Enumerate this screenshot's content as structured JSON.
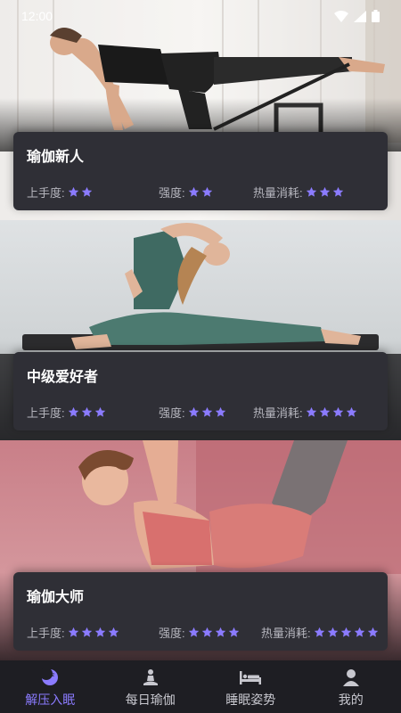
{
  "status_bar": {
    "time": "12:00"
  },
  "programs": [
    {
      "title": "瑜伽新人",
      "stats": [
        {
          "label": "上手度:",
          "stars": 2
        },
        {
          "label": "强度:",
          "stars": 2
        },
        {
          "label": "热量消耗:",
          "stars": 3
        }
      ]
    },
    {
      "title": "中级爱好者",
      "stats": [
        {
          "label": "上手度:",
          "stars": 3
        },
        {
          "label": "强度:",
          "stars": 3
        },
        {
          "label": "热量消耗:",
          "stars": 4
        }
      ]
    },
    {
      "title": "瑜伽大师",
      "stats": [
        {
          "label": "上手度:",
          "stars": 4
        },
        {
          "label": "强度:",
          "stars": 4
        },
        {
          "label": "热量消耗:",
          "stars": 5
        }
      ]
    }
  ],
  "tabs": [
    {
      "label": "解压入眠",
      "icon": "moon-icon",
      "active": true
    },
    {
      "label": "每日瑜伽",
      "icon": "meditation-pose-icon",
      "active": false
    },
    {
      "label": "睡眠姿势",
      "icon": "bed-icon",
      "active": false
    },
    {
      "label": "我的",
      "icon": "user-icon",
      "active": false
    }
  ],
  "colors": {
    "accent": "#8b7bff",
    "star": "#8b7bff",
    "card_bg": "#2f2f36",
    "tab_bar_bg": "#1e1e23"
  }
}
